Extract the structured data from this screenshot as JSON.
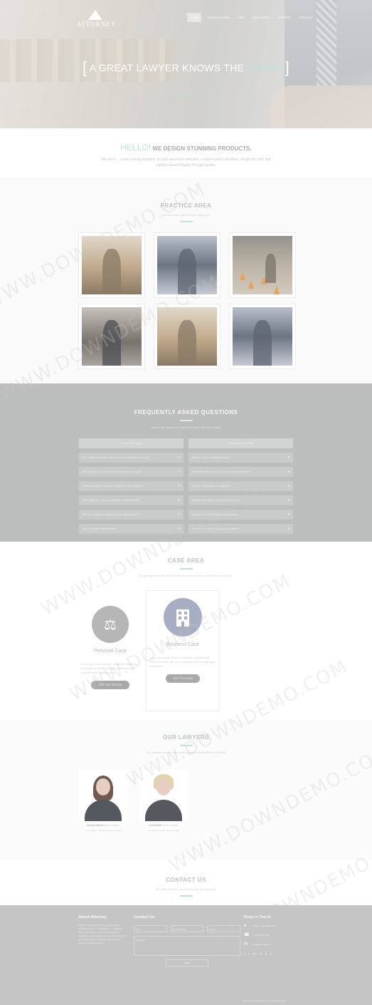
{
  "nav": {
    "logo": "ATTORNEY",
    "items": [
      "HOME",
      "PRACTICE AREA",
      "FAQ",
      "CASE AREA",
      "LAWYERS",
      "CONTACT"
    ]
  },
  "hero": {
    "bracket_left": "[",
    "title_main": "A GREAT LAWYER KNOWS THE ",
    "title_highlight": "JUDGE",
    "bracket_right": "]",
    "scroll_icon": "chevron-down"
  },
  "hello": {
    "greeting": "HELLO!",
    "headline": "WE DESIGN STUNNING PRODUCTS.",
    "text": "We are a ... team working together to craft awesome websites, creative brand identities, design for print and capture visual imagery through quality."
  },
  "practice": {
    "title": "PRACTICE AREA",
    "subtitle": "We are here to provide you legal help"
  },
  "faq": {
    "title": "FREQUENTLY ASKED QUESTIONS",
    "subtitle": "Here is the answer to some frequently asked questions",
    "left": {
      "header": "Crime Law FAQs",
      "items": [
        "Am I liable for allowing men to use my computer to do crime?",
        "What happens if I cannot to do business for a couple?",
        "What legal help do I need to complete in the business?",
        "What rights do I need to remember in the business?",
        "How do I change my business tax in right country?",
        "How to Create a Stream Plan?"
      ]
    },
    "right": {
      "header": "Business Law FAQs",
      "items": [
        "Why do I need a business lawyer?",
        "Why does it take so long to close corporate lawsuits?",
        "Should I incorporate my business?",
        "What are the steps to setting my business?",
        "What are the risks of selling my business?",
        "What are the steps in buying my business?"
      ]
    }
  },
  "case": {
    "title": "CASE AREA",
    "subtitle": "Everything will be fine & Deal with the issue at hand, while we look for your...",
    "cards": [
      {
        "name": "Personal Case",
        "icon": "scales-icon",
        "desc": "Lorem ipsum dolor sit amet, consectetur adipiscing elit. Nullam in lobortis velit, quis vestibulum eros. Duis elit augue, ullamcorper eu.",
        "button": "VISIT OUR SERVICE"
      },
      {
        "name": "Business Case",
        "icon": "building-icon",
        "desc": "Lorem ipsum dolor sit amet, consectetur adipiscing elit. Nullam in lobortis velit, quis vestibulum eros. Duis elit augue, ullamcorper.",
        "button": "VISIT PROGRAM"
      }
    ]
  },
  "lawyers": {
    "title": "OUR LAWYERS",
    "subtitle": "The lawyers are also the most capable and qualified in the field",
    "people": [
      {
        "name": "Jessica Molina",
        "role": "Senior Lawyer",
        "bio": "Los Angeles, Trusted attorney partner"
      },
      {
        "name": "Lola Burlett",
        "role": "Senior Lawyer",
        "bio": "Specialist in family law and legal"
      }
    ]
  },
  "contact": {
    "title": "CONTACT US",
    "subtitle": "For better service, you're Welcome to contact us"
  },
  "footer": {
    "about_title": "About Attorney",
    "about_text": "Attorney Template is a clean, modern styled Business theme for showcasing your business. Architecture ipsum, we know how well these Corporation your website can look and its features and adjustments for the hasted fine-tips and elements suited for the job.",
    "contact_title": "Contact Us",
    "name_placeholder": "Name",
    "email_placeholder": "Email Address",
    "subject_placeholder": "Subject",
    "message_placeholder": "Message",
    "send_label": "SEND",
    "touch_title": "Keep in Touch",
    "address": "42 Sky Street, New York",
    "phone": "+1 (23) 456-7890",
    "email": "info@attorney.com",
    "socials": [
      "f",
      "t",
      "g+",
      "in",
      "p",
      "v"
    ],
    "copyright": "Copyright © 2015 Attorney. All rights reserved."
  },
  "watermark": "WWW.DOWNDEMO.COM"
}
